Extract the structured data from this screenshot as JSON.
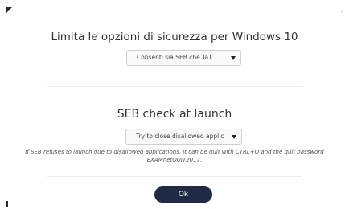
{
  "security": {
    "title": "Limita le opzioni di sicurezza per Windows 10",
    "selected_option": "Consenti sia SEB che TaT"
  },
  "seb_check": {
    "title": "SEB check at launch",
    "selected_option": "Try to close disallowed applic",
    "note": "If SEB refuses to launch due to disallowed applications, it can be quit with CTRL+Q and the quit password EXAMnetQUIT2017."
  },
  "footer": {
    "ok_label": "Ok"
  },
  "icons": {
    "dropdown": "chevron-down-icon"
  },
  "colors": {
    "button_background": "#1f2a44",
    "button_text": "#ffffff",
    "title_text": "#333333",
    "divider": "#eeeeee"
  }
}
